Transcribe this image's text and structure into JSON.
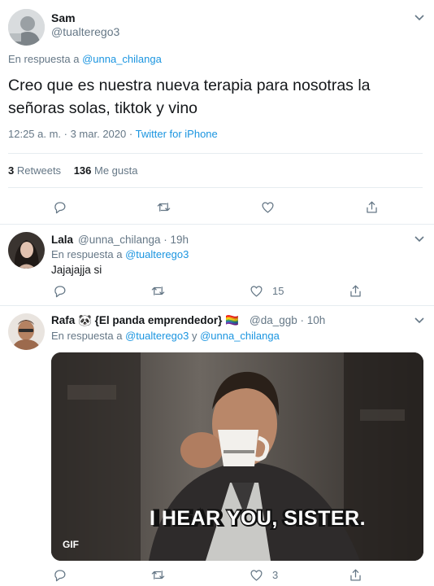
{
  "main_tweet": {
    "name": "Sam",
    "handle": "@tualterego3",
    "reply_prefix": "En respuesta a",
    "reply_to": "@unna_chilanga",
    "text": "Creo que es nuestra nueva terapia para nosotras la señoras solas, tiktok y vino",
    "time": "12:25 a. m. · 3 mar. 2020",
    "separator": "·",
    "source": "Twitter for iPhone",
    "retweets_count": "3",
    "retweets_label": "Retweets",
    "likes_count": "136",
    "likes_label": "Me gusta"
  },
  "reply1": {
    "name": "Lala",
    "handle_time": "@unna_chilanga · 19h",
    "reply_prefix": "En respuesta a",
    "reply_to": "@tualterego3",
    "text": "Jajajajja si",
    "like_count": "15"
  },
  "reply2": {
    "name": "Rafa 🐼 {El panda emprendedor} 🏳️‍🌈",
    "handle_time": "@da_ggb · 10h",
    "reply_prefix": "En respuesta a",
    "reply_to_1": "@tualterego3",
    "conj": "y",
    "reply_to_2": "@unna_chilanga",
    "gif_caption": "I HEAR YOU, SISTER.",
    "gif_badge": "GIF",
    "like_count": "3"
  },
  "icons": {
    "reply": "reply-icon",
    "retweet": "retweet-icon",
    "like": "heart-icon",
    "share": "share-icon",
    "caret": "chevron-down-icon"
  },
  "colors": {
    "link": "#1b95e0",
    "muted": "#657786",
    "divider": "#e6ecf0"
  }
}
